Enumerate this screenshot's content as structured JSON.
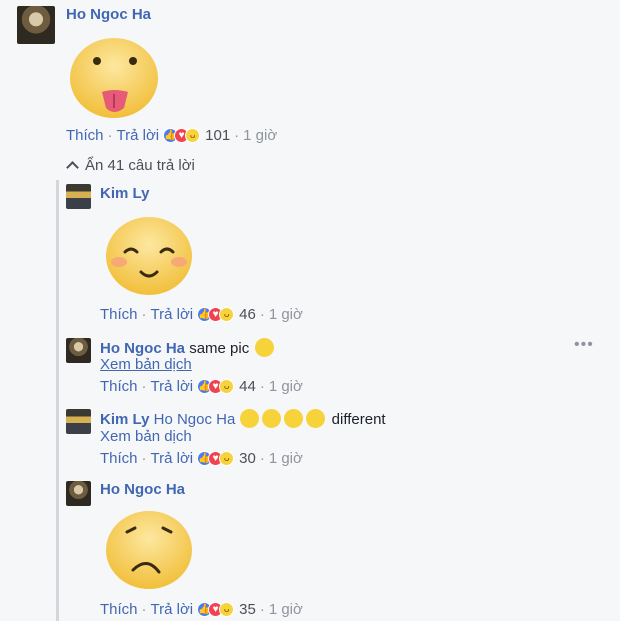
{
  "comments": [
    {
      "name": "Ho Ngoc Ha",
      "like": "Thích",
      "reply": "Trả lời",
      "count": "101",
      "time": "1 giờ"
    },
    {
      "name": "Kim Ly",
      "like": "Thích",
      "reply": "Trả lời",
      "count": "46",
      "time": "1 giờ"
    },
    {
      "name": "Ho Ngoc Ha",
      "text": "same pic",
      "translate": "Xem bản dịch",
      "like": "Thích",
      "reply": "Trả lời",
      "count": "44",
      "time": "1 giờ"
    },
    {
      "name": "Kim Ly",
      "mention": "Ho Ngoc Ha",
      "text": "different",
      "translate": "Xem bản dịch",
      "like": "Thích",
      "reply": "Trả lời",
      "count": "30",
      "time": "1 giờ"
    },
    {
      "name": "Ho Ngoc Ha",
      "like": "Thích",
      "reply": "Trả lời",
      "count": "35",
      "time": "1 giờ"
    }
  ],
  "toggle": {
    "label": "Ẩn 41 câu trả lời"
  },
  "separators": {
    "dot": "·"
  },
  "colors": {
    "link": "#4267b2",
    "sticker": "#f7d33b",
    "like": "#4a7cf6",
    "love": "#f0434f",
    "haha": "#f7d33b"
  },
  "icons": {
    "more": "more-options-icon",
    "chevron": "chevron-up-icon",
    "reactions": [
      "like-reaction-icon",
      "love-reaction-icon",
      "haha-reaction-icon"
    ]
  }
}
